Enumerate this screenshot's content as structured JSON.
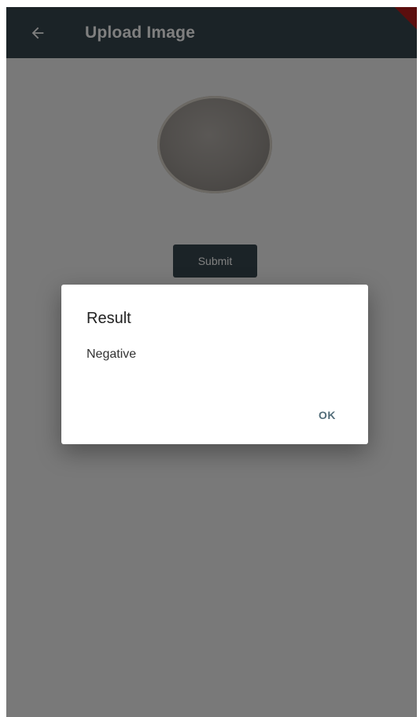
{
  "app_bar": {
    "title": "Upload Image",
    "back_icon": "arrow-left-icon",
    "color": "#37474f"
  },
  "content": {
    "submit_label": "Submit"
  },
  "dialog": {
    "title": "Result",
    "message": "Negative",
    "ok_label": "OK"
  }
}
